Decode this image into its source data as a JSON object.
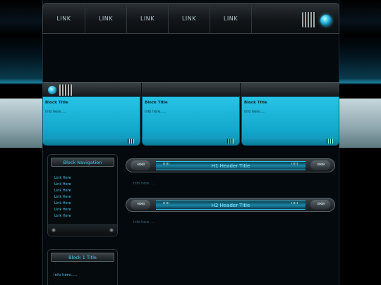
{
  "nav": {
    "links": [
      "LINK",
      "LINK",
      "LINK",
      "LINK",
      "LINK"
    ]
  },
  "blocks": [
    {
      "title": "Block Title",
      "info": "info here....."
    },
    {
      "title": "Block Title",
      "info": "info here....."
    },
    {
      "title": "Block Title",
      "info": "info here....."
    }
  ],
  "sidebar": {
    "nav_title": "Block Navigation",
    "links": [
      "Link Here",
      "Link Here",
      "Link Here",
      "Link Here",
      "Link Here",
      "Link Here",
      "Link Here"
    ],
    "block1_title": "Block 1 Title",
    "block1_info": "info here....."
  },
  "content": {
    "h1_title": "H1 Header Title",
    "h1_info": "Info here.....",
    "h2_title": "H2 Header Title",
    "h2_info": "Info here....."
  },
  "glyphs": {
    "arrow_left": "«««",
    "arrow_right": "»»»"
  },
  "colors": {
    "accent_cyan": "#27c3e6",
    "link_cyan": "#44c6ec",
    "dark_bg": "#03090d"
  }
}
